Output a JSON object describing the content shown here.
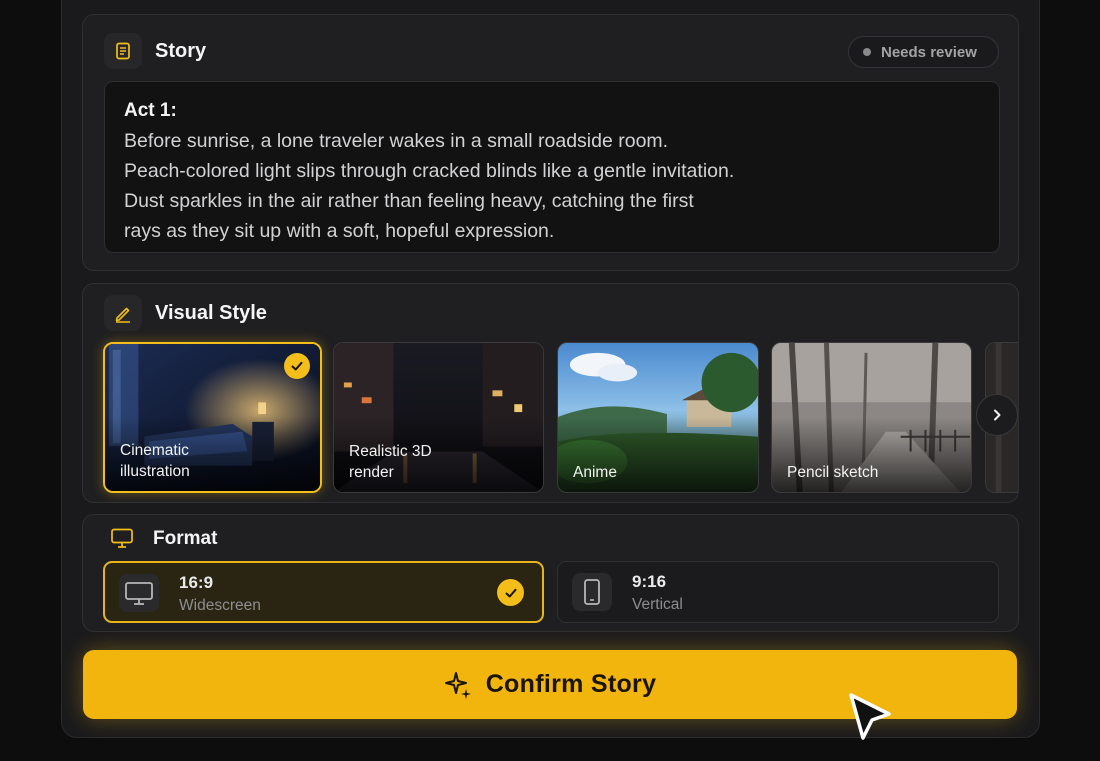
{
  "story": {
    "title": "Story",
    "status": "Needs review",
    "act": "Act 1:",
    "lines": [
      "Before sunrise, a lone traveler wakes in a small roadside room.",
      "Peach-colored light slips through cracked blinds like a gentle invitation.",
      "Dust sparkles in the air rather than feeling heavy, catching the first",
      "rays as they sit up with a soft, hopeful expression."
    ]
  },
  "visual_style": {
    "title": "Visual Style",
    "options": [
      {
        "line1": "Cinematic",
        "line2": "illustration",
        "selected": true
      },
      {
        "line1": "Realistic 3D",
        "line2": "render",
        "selected": false
      },
      {
        "line1": "Anime",
        "line2": "",
        "selected": false
      },
      {
        "line1": "Pencil sketch",
        "line2": "",
        "selected": false
      }
    ]
  },
  "format": {
    "title": "Format",
    "options": [
      {
        "ratio": "16:9",
        "name": "Widescreen",
        "selected": true
      },
      {
        "ratio": "9:16",
        "name": "Vertical",
        "selected": false
      }
    ]
  },
  "confirm_label": "Confirm Story",
  "colors": {
    "accent": "#f4be1a",
    "card": "#1f1f21",
    "bg": "#0d0d0e"
  },
  "icons": [
    "document-icon",
    "pen-icon",
    "monitor-icon",
    "phone-icon",
    "check-icon",
    "chevron-right-icon",
    "sparkle-icon",
    "cursor-arrow-icon"
  ]
}
